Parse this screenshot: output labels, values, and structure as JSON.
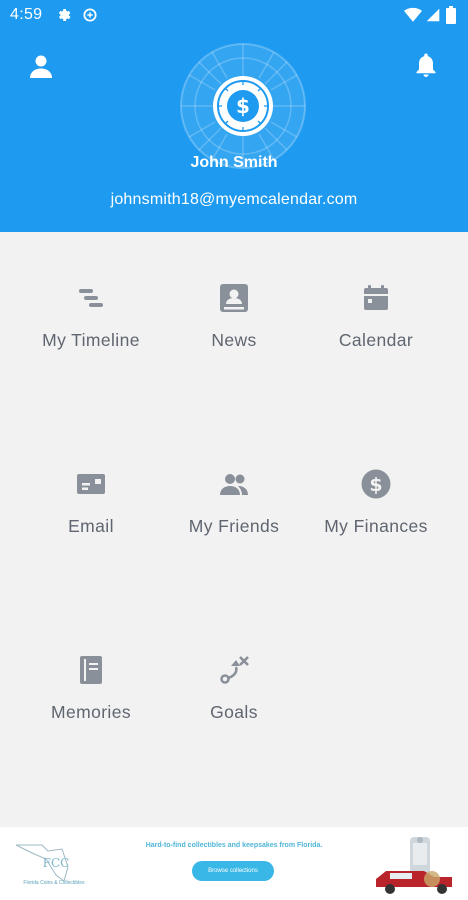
{
  "status_bar": {
    "time": "4:59"
  },
  "profile": {
    "name": "John Smith",
    "email": "johnsmith18@myemcalendar.com"
  },
  "menu": [
    {
      "label": "My Timeline"
    },
    {
      "label": "News"
    },
    {
      "label": "Calendar"
    },
    {
      "label": "Email"
    },
    {
      "label": "My Friends"
    },
    {
      "label": "My Finances"
    },
    {
      "label": "Memories"
    },
    {
      "label": "Goals"
    }
  ],
  "ad": {
    "logo_text": "Florida Coins & Collectibles",
    "logo_mark": "FCC",
    "headline": "Hard-to-find collectibles and keepsakes from Florida.",
    "button": "Browse collections"
  },
  "colors": {
    "header": "#1e9bf0",
    "icon": "#8a9099",
    "label": "#5f6670",
    "background": "#f2f2f2"
  }
}
